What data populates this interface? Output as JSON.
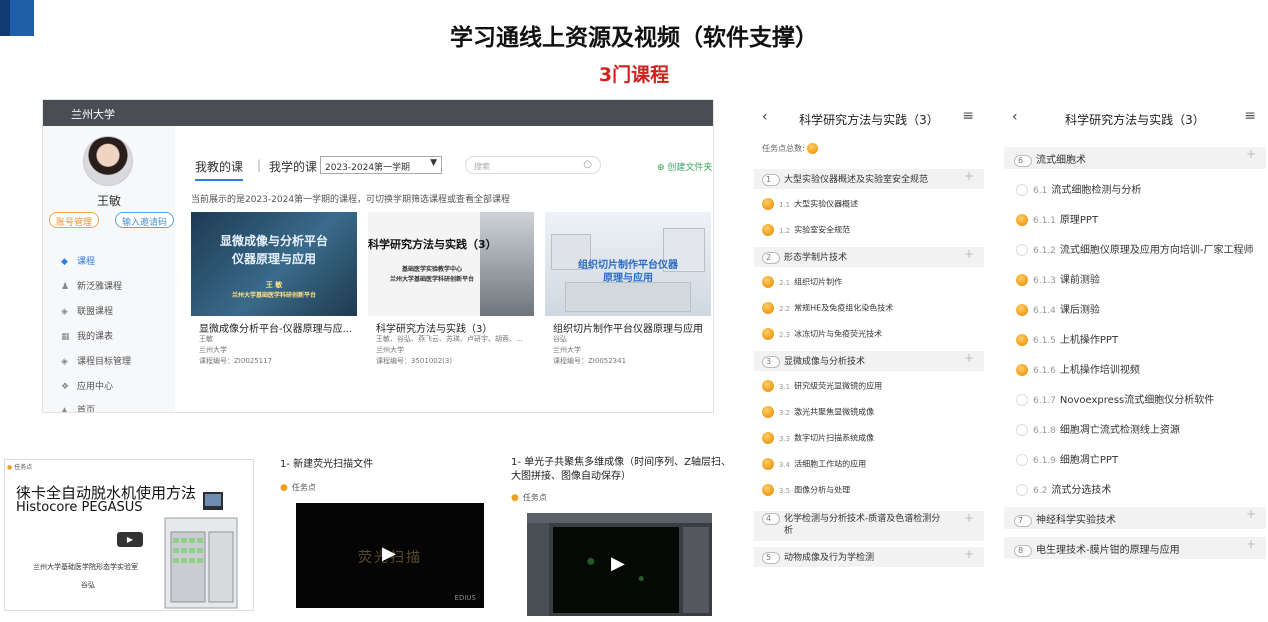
{
  "header": {
    "title": "学习通线上资源及视频（软件支撑）",
    "subtitle": "3门课程"
  },
  "lms": {
    "university": "兰州大学",
    "user_name": "王敏",
    "account_btn": "账号管理",
    "invite_btn": "输入邀请码",
    "sidebar": [
      "课程",
      "新泛雅课程",
      "联盟课程",
      "我的课表",
      "课程目标管理",
      "应用中心",
      "首页"
    ],
    "tab_my_teaching": "我教的课",
    "tab_separator": "|",
    "tab_my_learning": "我学的课",
    "term_selected": "2023-2024第一学期",
    "search_placeholder": "搜索",
    "new_folder": "创建文件夹",
    "semester_note": "当前展示的是2023-2024第一学期的课程，可切换学期筛选课程或查看全部课程",
    "courses": [
      {
        "cover_title_1": "显微成像与分析平台",
        "cover_title_2": "仪器原理与应用",
        "cover_author": "王 敏",
        "cover_org": "兰州大学基础医学科研创新平台",
        "name": "显微成像分析平台-仪器原理与应...",
        "teacher": "王敏",
        "school": "兰州大学",
        "code": "课程编号：ZI0025117"
      },
      {
        "cover_title": "科学研究方法与实践（3）",
        "cover_line_1": "基础医学实验教学中心",
        "cover_line_2": "兰州大学基础医学科研创新平台",
        "name": "科学研究方法与实践（3）",
        "teacher": "王敏、谷弘、燕飞云、苏瑛、卢研宇、胡蓉、...",
        "school": "兰州大学",
        "code": "课程编号：3501002(3)"
      },
      {
        "cover_title_1": "组织切片制作平台仪器",
        "cover_title_2": "原理与应用",
        "name": "组织切片制作平台仪器原理与应用",
        "teacher": "谷弘",
        "school": "兰州大学",
        "code": "课程编号：ZI0052341"
      }
    ]
  },
  "slides": {
    "slide1_task": "任务点",
    "slide1_title_1": "徕卡全自动脱水机使用方法",
    "slide1_title_2": "Histocore PEGASUS",
    "slide1_org": "兰州大学基础医学院形态学实验室",
    "slide1_author": "谷弘",
    "video2_title": "1- 新建荧光扫描文件",
    "video2_task": "任务点",
    "video2_overlay": "荧光扫描",
    "video2_brand": "EDIUS",
    "video3_title": "1- 单光子共聚焦多维成像（时间序列、Z轴层扫、大图拼接、图像自动保存）",
    "video3_task": "任务点"
  },
  "mobile1": {
    "title": "科学研究方法与实践（3）",
    "task_total_label": "任务点总数:",
    "rows": [
      {
        "type": "chapter",
        "num": "1",
        "label": "大型实验仪器概述及实验室安全规范"
      },
      {
        "type": "section",
        "num": "1.1",
        "label": "大型实验仪器概述"
      },
      {
        "type": "section",
        "num": "1.2",
        "label": "实验室安全规范"
      },
      {
        "type": "chapter",
        "num": "2",
        "label": "形态学制片技术"
      },
      {
        "type": "section",
        "num": "2.1",
        "label": "组织切片制作"
      },
      {
        "type": "section",
        "num": "2.2",
        "label": "常规HE及免疫组化染色技术"
      },
      {
        "type": "section",
        "num": "2.3",
        "label": "冰冻切片与免疫荧光技术"
      },
      {
        "type": "chapter",
        "num": "3",
        "label": "显微成像与分析技术"
      },
      {
        "type": "section",
        "num": "3.1",
        "label": "研究级荧光显微镜的应用"
      },
      {
        "type": "section",
        "num": "3.2",
        "label": "激光共聚焦显微镜成像"
      },
      {
        "type": "section",
        "num": "3.3",
        "label": "数字切片扫描系统成像"
      },
      {
        "type": "section",
        "num": "3.4",
        "label": "活细胞工作站的应用"
      },
      {
        "type": "section",
        "num": "3.5",
        "label": "图像分析与处理"
      },
      {
        "type": "chapter",
        "num": "4",
        "label": "化学检测与分析技术-质谱及色谱检测分析"
      },
      {
        "type": "chapter",
        "num": "5",
        "label": "动物成像及行为学检测"
      }
    ]
  },
  "mobile2": {
    "title": "科学研究方法与实践（3）",
    "rows": [
      {
        "type": "chapter",
        "num": "6",
        "label": "流式细胞术"
      },
      {
        "type": "section",
        "done": false,
        "num": "6.1",
        "label": "流式细胞检测与分析"
      },
      {
        "type": "section",
        "done": true,
        "num": "6.1.1",
        "label": "原理PPT"
      },
      {
        "type": "section",
        "done": false,
        "num": "6.1.2",
        "label": "流式细胞仪原理及应用方向培训-厂家工程师"
      },
      {
        "type": "section",
        "done": true,
        "num": "6.1.3",
        "label": "课前测验"
      },
      {
        "type": "section",
        "done": true,
        "num": "6.1.4",
        "label": "课后测验"
      },
      {
        "type": "section",
        "done": true,
        "num": "6.1.5",
        "label": "上机操作PPT"
      },
      {
        "type": "section",
        "done": true,
        "num": "6.1.6",
        "label": "上机操作培训视频"
      },
      {
        "type": "section",
        "done": false,
        "num": "6.1.7",
        "label": "Novoexpress流式细胞仪分析软件"
      },
      {
        "type": "section",
        "done": false,
        "num": "6.1.8",
        "label": "细胞凋亡流式检测线上资源"
      },
      {
        "type": "section",
        "done": false,
        "num": "6.1.9",
        "label": "细胞凋亡PPT"
      },
      {
        "type": "section",
        "done": false,
        "num": "6.2",
        "label": "流式分选技术"
      },
      {
        "type": "chapter",
        "num": "7",
        "label": "神经科学实验技术"
      },
      {
        "type": "chapter",
        "num": "8",
        "label": "电生理技术-膜片钳的原理与应用"
      }
    ]
  },
  "colors": {
    "accent": "#2f7de1",
    "subtitle_red": "#d0231d",
    "task_orange": "#f09a16"
  }
}
